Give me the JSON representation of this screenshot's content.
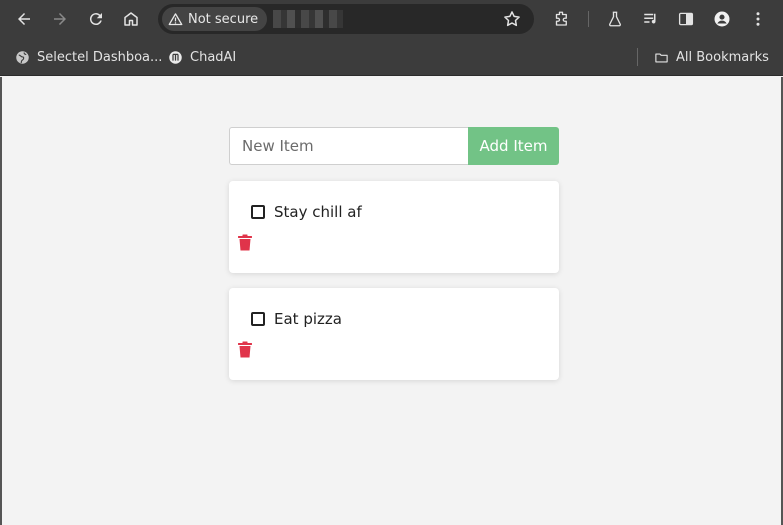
{
  "browser": {
    "security_label": "Not secure",
    "bookmarks": [
      {
        "label": "Selectel Dashboa...",
        "icon": "globe-icon"
      },
      {
        "label": "ChadAI",
        "icon": "chadai-icon"
      }
    ],
    "all_bookmarks_label": "All Bookmarks"
  },
  "app": {
    "input_placeholder": "New Item",
    "input_value": "",
    "add_button_label": "Add Item",
    "accent_color": "#72c386",
    "delete_color": "#e0344a",
    "items": [
      {
        "text": "Stay chill af",
        "checked": false
      },
      {
        "text": "Eat pizza",
        "checked": false
      }
    ]
  }
}
